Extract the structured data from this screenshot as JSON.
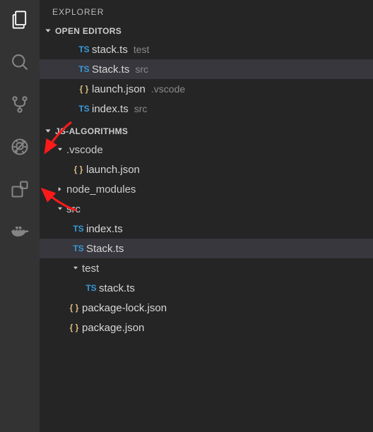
{
  "sidebar_title": "EXPLORER",
  "open_editors": {
    "title": "OPEN EDITORS",
    "items": [
      {
        "icon": "ts",
        "name": "stack.ts",
        "hint": "test"
      },
      {
        "icon": "ts",
        "name": "Stack.ts",
        "hint": "src",
        "selected": true
      },
      {
        "icon": "json",
        "name": "launch.json",
        "hint": ".vscode"
      },
      {
        "icon": "ts",
        "name": "index.ts",
        "hint": "src"
      }
    ]
  },
  "workspace": {
    "title": "JS-ALGORITHMS",
    "tree": {
      "vscode_folder": ".vscode",
      "launch_json": "launch.json",
      "node_modules": "node_modules",
      "src_folder": "src",
      "index_ts": "index.ts",
      "stack_ts_src": "Stack.ts",
      "test_folder": "test",
      "stack_ts_test": "stack.ts",
      "package_lock": "package-lock.json",
      "package_json": "package.json"
    }
  },
  "icons": {
    "ts": "TS",
    "json": "{ }"
  }
}
